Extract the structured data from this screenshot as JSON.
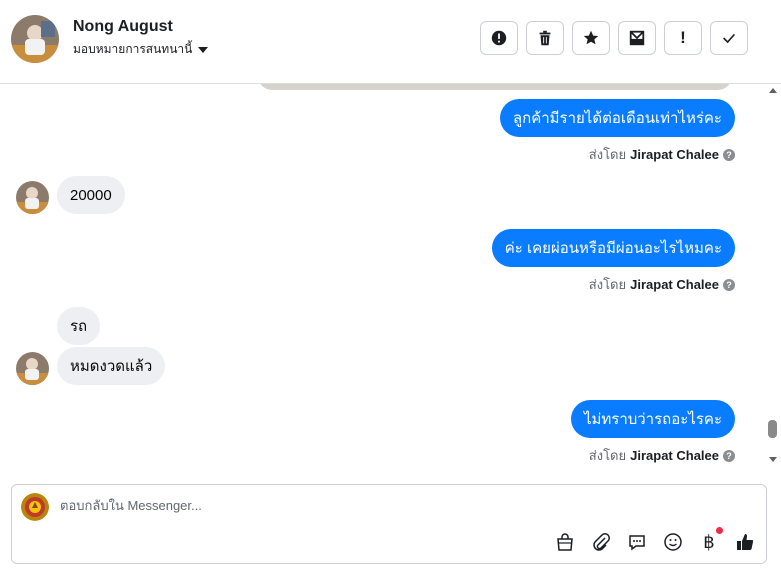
{
  "header": {
    "contact_name": "Nong August",
    "assign_label": "มอบหมายการสนทนานี้"
  },
  "toolbar": [
    {
      "name": "spam-icon-button",
      "icon": "exclamation-circle-icon"
    },
    {
      "name": "delete-button",
      "icon": "trash-icon"
    },
    {
      "name": "star-button",
      "icon": "star-icon"
    },
    {
      "name": "mark-unread-button",
      "icon": "envelope-icon"
    },
    {
      "name": "follow-up-button",
      "icon": "exclamation-icon",
      "text": "!"
    },
    {
      "name": "done-button",
      "icon": "check-icon"
    }
  ],
  "messages": [
    {
      "direction": "out",
      "text": "ลูกค้ามีรายได้ต่อเดือนเท่าไหร่คะ",
      "sent_by_prefix": "ส่งโดย",
      "sent_by_name": "Jirapat Chalee"
    },
    {
      "direction": "in",
      "text": "20000"
    },
    {
      "direction": "out",
      "text": "ค่ะ เคยผ่อนหรือมีผ่อนอะไรไหมคะ",
      "sent_by_prefix": "ส่งโดย",
      "sent_by_name": "Jirapat Chalee"
    },
    {
      "direction": "in",
      "text": "รถ"
    },
    {
      "direction": "in",
      "text": "หมดงวดแล้ว"
    },
    {
      "direction": "out",
      "text": "ไม่ทราบว่ารถอะไรคะ",
      "sent_by_prefix": "ส่งโดย",
      "sent_by_name": "Jirapat Chalee"
    }
  ],
  "composer": {
    "placeholder": "ตอบกลับใน Messenger...",
    "value": "",
    "tools": [
      "shopping-bag-icon",
      "paperclip-icon",
      "saved-reply-icon",
      "emoji-icon",
      "baht-icon",
      "like-icon"
    ],
    "baht_symbol": "฿"
  },
  "colors": {
    "accent": "#0a7cff",
    "incoming_bubble": "#eeeff2",
    "notification_dot": "#f02849"
  }
}
